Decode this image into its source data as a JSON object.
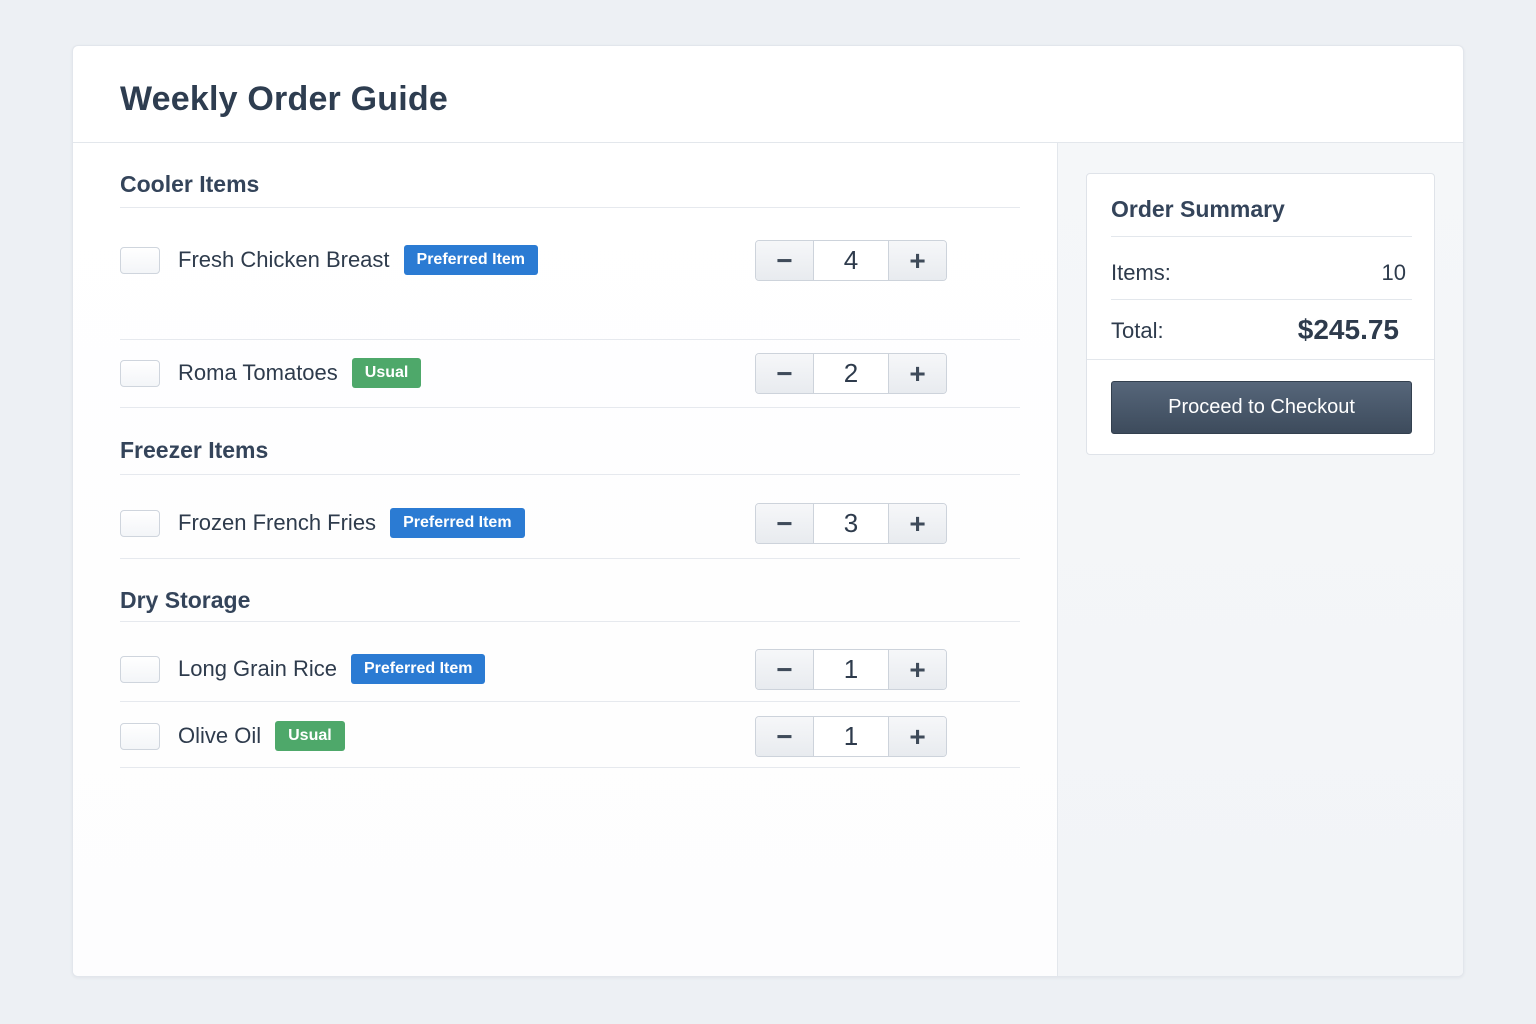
{
  "page": {
    "title": "Weekly Order Guide"
  },
  "sections": [
    {
      "title": "Cooler Items",
      "items": [
        {
          "name": "Fresh Chicken Breast",
          "badge": "Preferred Item",
          "badge_type": "preferred",
          "quantity": "4",
          "checked": false
        },
        {
          "name": "Roma Tomatoes",
          "badge": "Usual",
          "badge_type": "usual",
          "quantity": "2",
          "checked": false
        }
      ]
    },
    {
      "title": "Freezer Items",
      "items": [
        {
          "name": "Frozen French Fries",
          "badge": "Preferred Item",
          "badge_type": "preferred",
          "quantity": "3",
          "checked": false
        }
      ]
    },
    {
      "title": "Dry Storage",
      "items": [
        {
          "name": "Long Grain Rice",
          "badge": "Preferred Item",
          "badge_type": "preferred",
          "quantity": "1",
          "checked": false
        },
        {
          "name": "Olive Oil",
          "badge": "Usual",
          "badge_type": "usual",
          "quantity": "1",
          "checked": false
        }
      ]
    }
  ],
  "stepper": {
    "decrement_symbol": "−",
    "increment_symbol": "+"
  },
  "summary": {
    "title": "Order Summary",
    "items_label": "Items:",
    "items_value": "10",
    "total_label": "Total:",
    "total_value": "$245.75",
    "checkout_label": "Proceed to Checkout"
  },
  "colors": {
    "preferred_badge": "#2b7bd3",
    "usual_badge": "#4ea86a",
    "checkout_button": "#46556a"
  },
  "icons": {
    "minus": "minus-icon",
    "plus": "plus-icon"
  }
}
